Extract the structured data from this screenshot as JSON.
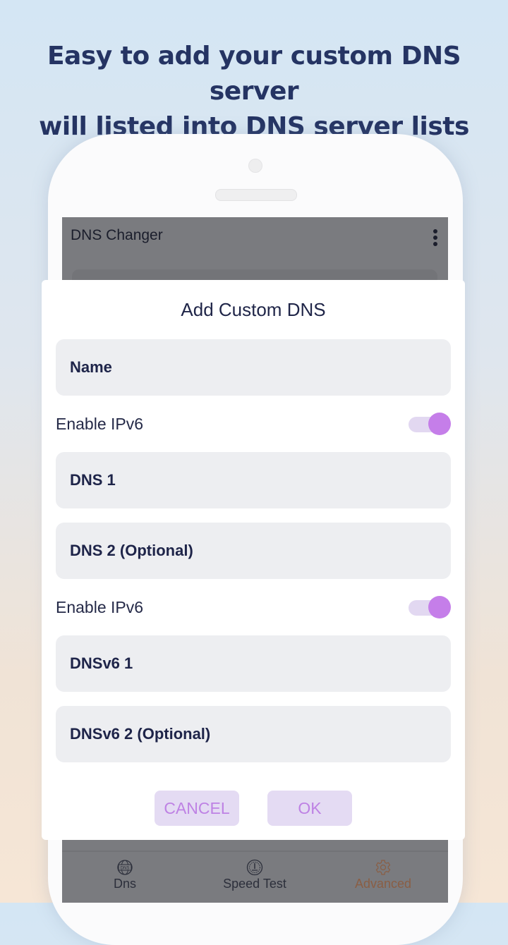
{
  "headline": {
    "line1": "Easy to add your custom DNS server",
    "line2": "will listed into DNS server lists"
  },
  "app_bar": {
    "title": "DNS Changer",
    "menu_icon": "more-vert-icon"
  },
  "dialog": {
    "title": "Add Custom DNS",
    "fields": [
      {
        "placeholder": "Name"
      },
      {
        "placeholder": "DNS 1"
      },
      {
        "placeholder": "DNS 2 (Optional)"
      },
      {
        "placeholder": "DNSv6 1"
      },
      {
        "placeholder": "DNSv6 2 (Optional)"
      }
    ],
    "toggles": [
      {
        "label": "Enable IPv6",
        "on": true
      },
      {
        "label": "Enable IPv6",
        "on": true
      }
    ],
    "cancel_label": "CANCEL",
    "ok_label": "OK"
  },
  "bottom_nav": {
    "items": [
      {
        "label": "Dns",
        "icon": "dns-globe-icon",
        "active": false
      },
      {
        "label": "Speed Test",
        "icon": "speedometer-icon",
        "active": false
      },
      {
        "label": "Advanced",
        "icon": "gear-icon",
        "active": true
      }
    ]
  },
  "colors": {
    "accent": "#c57ee9",
    "headline": "#253463",
    "active_tab": "#8a5e44"
  }
}
